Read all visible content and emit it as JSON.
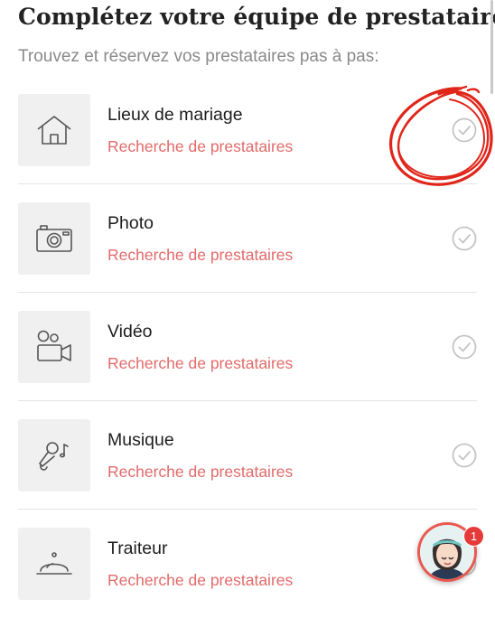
{
  "header": {
    "title": "Complétez votre équipe de prestataires",
    "subtitle": "Trouvez et réservez vos prestataires pas à pas:"
  },
  "vendors": [
    {
      "name": "Lieux de mariage",
      "link": "Recherche de prestataires",
      "icon": "house-icon"
    },
    {
      "name": "Photo",
      "link": "Recherche de prestataires",
      "icon": "camera-icon"
    },
    {
      "name": "Vidéo",
      "link": "Recherche de prestataires",
      "icon": "video-camera-icon"
    },
    {
      "name": "Musique",
      "link": "Recherche de prestataires",
      "icon": "microphone-music-icon"
    },
    {
      "name": "Traiteur",
      "link": "Recherche de prestataires",
      "icon": "cloche-icon"
    }
  ],
  "chat": {
    "badge_count": "1"
  },
  "colors": {
    "accent": "#e26a6a",
    "annotation": "#e0261b",
    "check": "#c4c4c4"
  }
}
